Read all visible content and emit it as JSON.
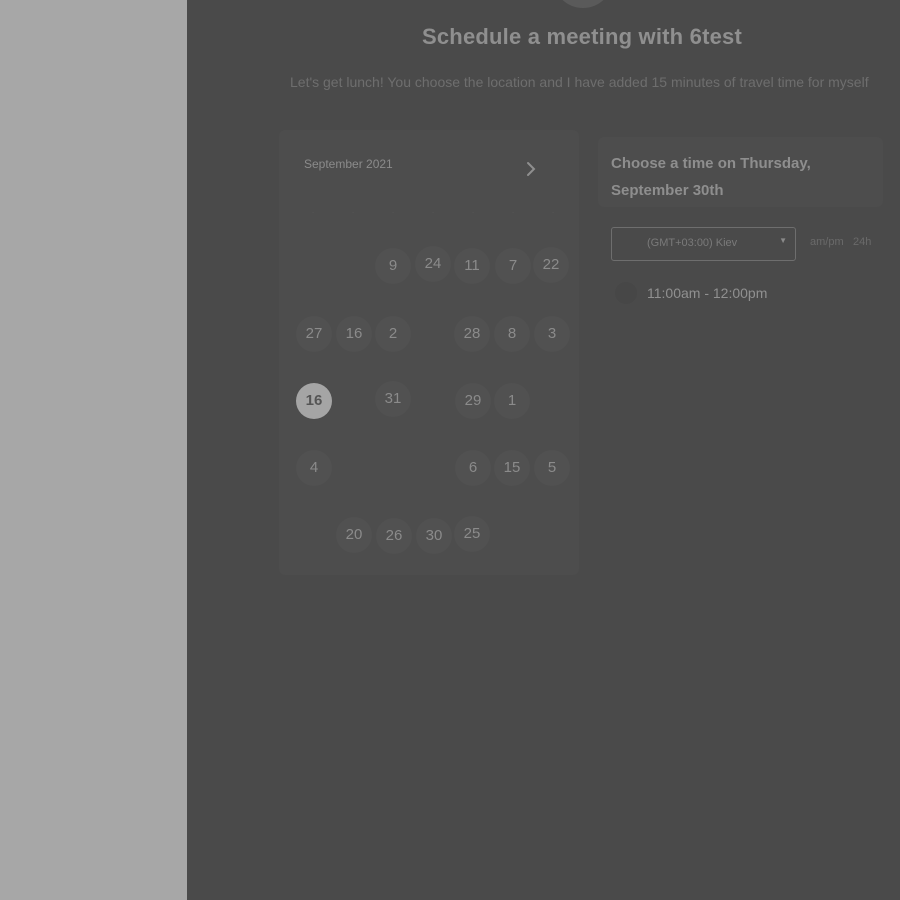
{
  "header": {
    "title": "Schedule a meeting with 6test",
    "subtitle": "Let's get lunch! You choose the location and I have added 15 minutes of travel time for myself"
  },
  "calendar": {
    "month": "September 2021",
    "next_icon": "chevron-right-icon",
    "days": [
      {
        "label": "9"
      },
      {
        "label": "24"
      },
      {
        "label": "11"
      },
      {
        "label": "7"
      },
      {
        "label": "22"
      },
      {
        "label": "27"
      },
      {
        "label": "16"
      },
      {
        "label": "2"
      },
      {
        "label": "28"
      },
      {
        "label": "8"
      },
      {
        "label": "3"
      },
      {
        "label": "16",
        "selected": true
      },
      {
        "label": "31"
      },
      {
        "label": "29"
      },
      {
        "label": "1"
      },
      {
        "label": "4"
      },
      {
        "label": "6"
      },
      {
        "label": "15"
      },
      {
        "label": "5"
      },
      {
        "label": "20"
      },
      {
        "label": "26"
      },
      {
        "label": "30"
      },
      {
        "label": "25"
      }
    ]
  },
  "time_picker": {
    "title": "Choose a time on Thursday, September 30th",
    "timezone": "(GMT+03:00) Kiev",
    "format_options": [
      "am/pm",
      "24h"
    ],
    "slots": [
      "11:00am - 12:00pm"
    ]
  },
  "colors": {
    "overlay": "#4a4a4a",
    "side_strip": "#a7a7a7",
    "selected_day": "#a5a5a5"
  }
}
